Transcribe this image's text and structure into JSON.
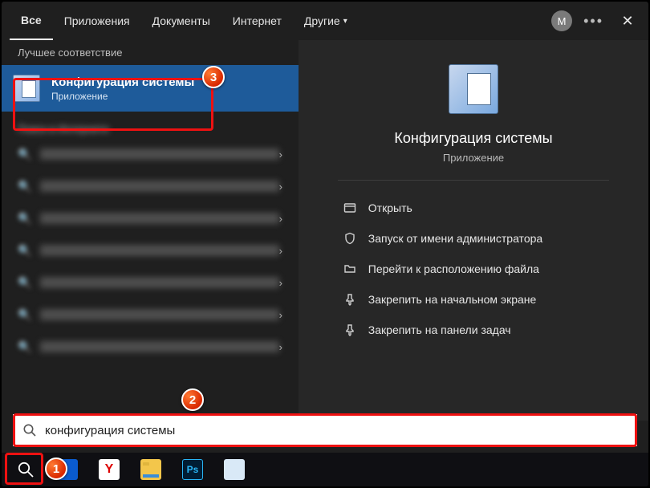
{
  "tabs": {
    "all": "Все",
    "apps": "Приложения",
    "docs": "Документы",
    "web": "Интернет",
    "more": "Другие"
  },
  "user_initial": "М",
  "left": {
    "best_label": "Лучшее соответствие",
    "best_title": "Конфигурация системы",
    "best_sub": "Приложение"
  },
  "preview": {
    "title": "Конфигурация системы",
    "sub": "Приложение",
    "actions": {
      "open": "Открыть",
      "admin": "Запуск от имени администратора",
      "location": "Перейти к расположению файла",
      "pin_start": "Закрепить на начальном экране",
      "pin_taskbar": "Закрепить на панели задач"
    }
  },
  "search": {
    "value": "конфигурация системы"
  },
  "badges": {
    "b1": "1",
    "b2": "2",
    "b3": "3"
  },
  "taskbar_icons": {
    "yandex": "Y",
    "ps": "Ps"
  }
}
